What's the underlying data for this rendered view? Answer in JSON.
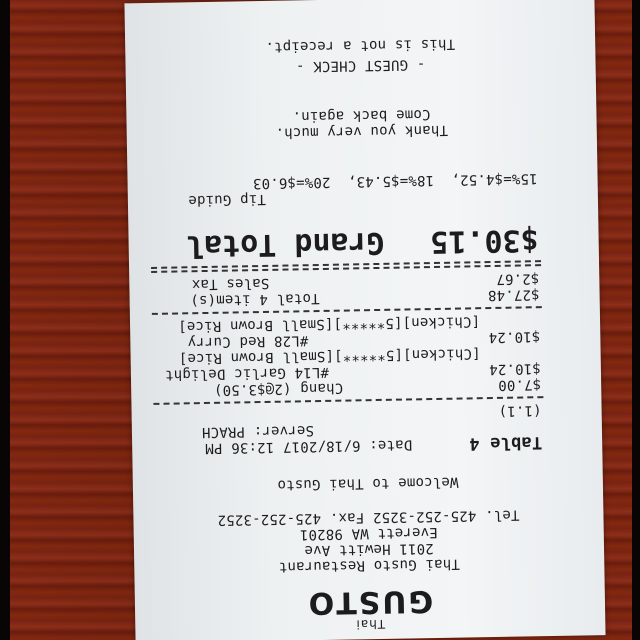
{
  "receipt": {
    "logo_small": "Thai",
    "logo_big": "GUSTO",
    "restaurant_name": "Thai Gusto Restaurant",
    "address_line1": "2011 Hewitt Ave",
    "address_line2": "Everett WA 98201",
    "phone_fax": "Tel. 425-252-3252 Fax. 425-252-3252",
    "welcome": "Welcome to Thai Gusto",
    "table": "Table 4",
    "date": "Date: 6/18/2017 12:36 PM",
    "server": "Server: PRACH",
    "guests": "(1.1)",
    "items": [
      {
        "name": "Chang (2@$3.50)",
        "price": "$7.00"
      },
      {
        "name": "#L14 Garlic Delight",
        "price": "$10.24"
      },
      {
        "name": "[Chicken][5*****][Small Brown Rice]",
        "price": ""
      },
      {
        "name": "#L28 Red Curry",
        "price": "$10.24"
      },
      {
        "name": "[Chicken][5*****][Small Brown Rice]",
        "price": ""
      }
    ],
    "total_items_label": "Total 4 item(s)",
    "total_items_value": "$27.48",
    "sales_tax_label": "Sales Tax",
    "sales_tax_value": "$2.67",
    "grand_total_label": "Grand Total",
    "grand_total_value": "$30.15",
    "tip_guide_label": "Tip Guide",
    "tip_guide_values": "15%=$4.52,  18%=$5.43,  20%=$6.03",
    "thank_you": "Thank you very much.",
    "come_back": "Come back again.",
    "guest_check": "- GUEST CHECK -",
    "not_receipt": "This is not a receipt."
  }
}
